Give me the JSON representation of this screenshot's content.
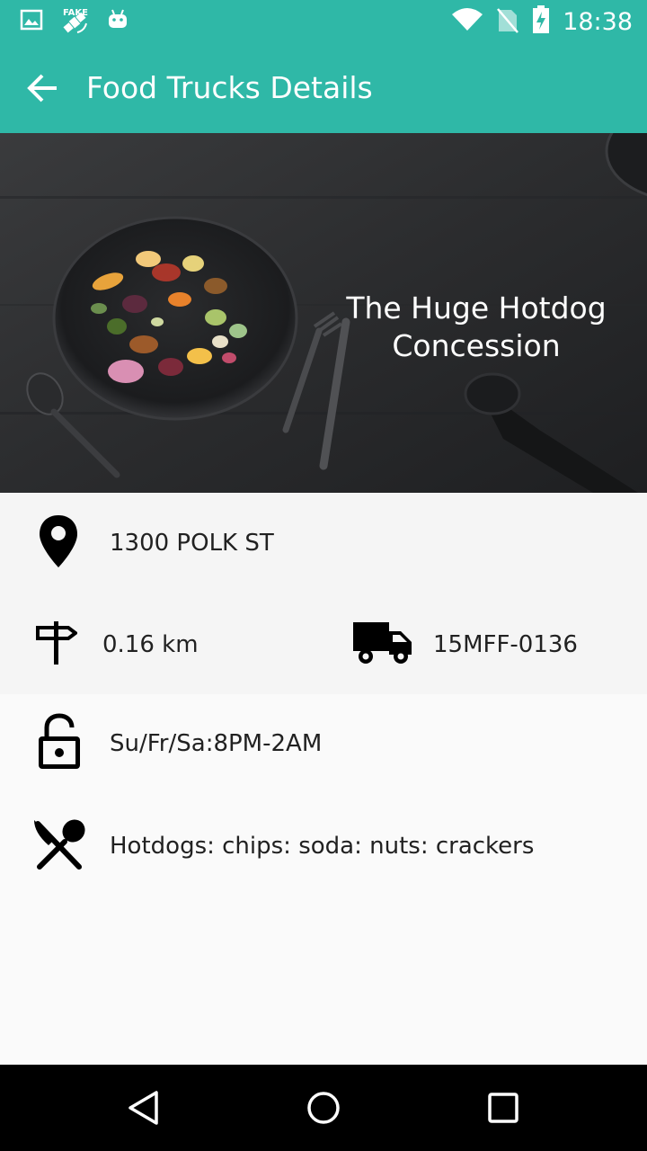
{
  "status_bar": {
    "time": "18:38",
    "left_icons": [
      "image-icon",
      "fake-gps-icon",
      "android-icon"
    ],
    "right_icons": [
      "wifi-icon",
      "no-sim-icon",
      "battery-charging-icon"
    ]
  },
  "app_bar": {
    "title": "Food Trucks Details",
    "back_icon": "arrow-back-icon",
    "color": "#2fb8a7"
  },
  "hero": {
    "truck_name": "The Huge Hotdog Concession"
  },
  "details": {
    "address": "1300 POLK ST",
    "distance": "0.16 km",
    "permit": "15MFF-0136",
    "hours": "Su/Fr/Sa:8PM-2AM",
    "food_items": "Hotdogs: chips: soda: nuts: crackers"
  },
  "nav_bar": {
    "buttons": [
      "back-triangle-icon",
      "home-circle-icon",
      "recents-square-icon"
    ]
  }
}
